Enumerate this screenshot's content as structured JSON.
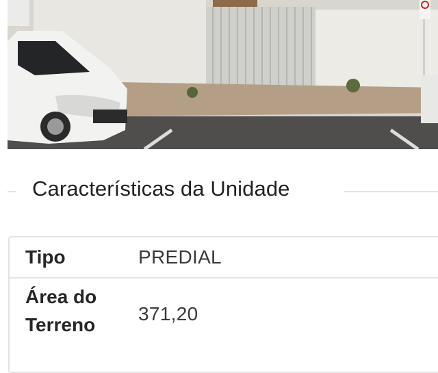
{
  "photo": {
    "subject": "building-facade-street-photo",
    "sign_icon": "no-parking-sign-icon",
    "colors": {
      "wall": "#e8e6df",
      "gate": "#c9c9c6",
      "street": "#5a5957",
      "car": "#f3f3f1"
    }
  },
  "section": {
    "title": "Características da Unidade"
  },
  "details": {
    "rows": [
      {
        "label": "Tipo",
        "value": "PREDIAL"
      },
      {
        "label": "Área do Terreno",
        "value": "371,20"
      }
    ]
  },
  "colors": {
    "divider": "#e3e3e3",
    "title_text": "#222222",
    "value_text": "#3a3a3a"
  }
}
